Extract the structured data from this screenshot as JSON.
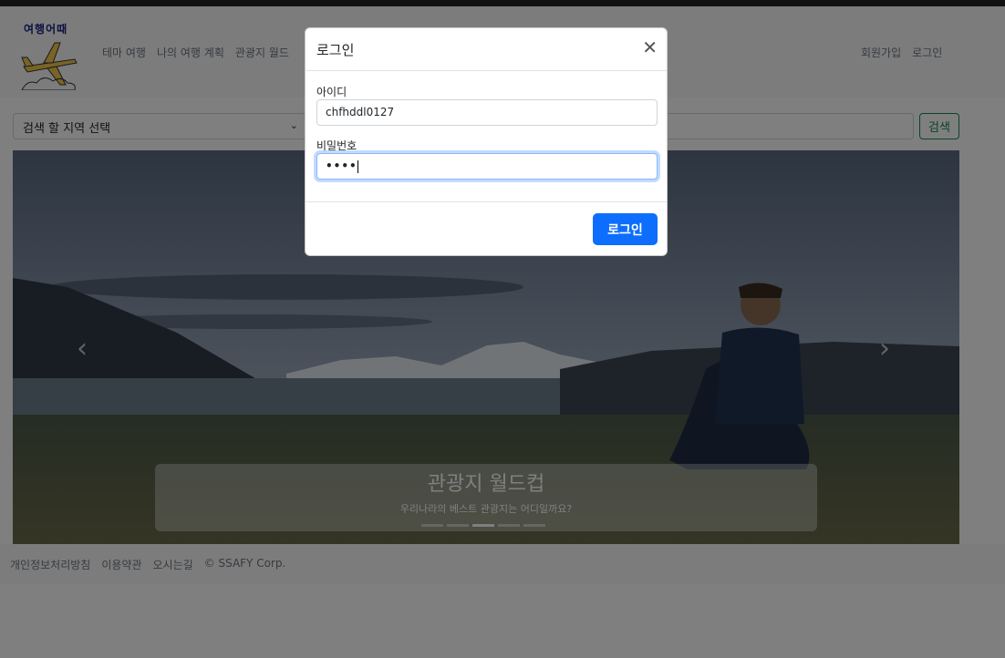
{
  "brand": {
    "logo_text": "여행어때"
  },
  "nav": {
    "items": [
      "테마 여행",
      "나의 여행 계획",
      "관광지 월드"
    ],
    "signup": "회원가입",
    "login": "로그인"
  },
  "search": {
    "region_placeholder": "검색 할 지역 선택",
    "button_label": "검색"
  },
  "carousel": {
    "title": "관광지 월드컵",
    "subtitle": "우리나라의 베스트 관광지는 어디일까요?",
    "slide_count": 5,
    "active_index": 2
  },
  "footer": {
    "links": [
      "개인정보처리방침",
      "이용약관",
      "오시는길",
      "© SSAFY Corp."
    ]
  },
  "modal": {
    "title": "로그인",
    "id_label": "아이디",
    "id_value": "chfhddl0127",
    "pw_label": "비밀번호",
    "pw_value": "••••",
    "submit_label": "로그인"
  },
  "colors": {
    "primary": "#0d6efd",
    "success": "#198754",
    "backdrop": "rgba(0,0,0,0.5)"
  }
}
